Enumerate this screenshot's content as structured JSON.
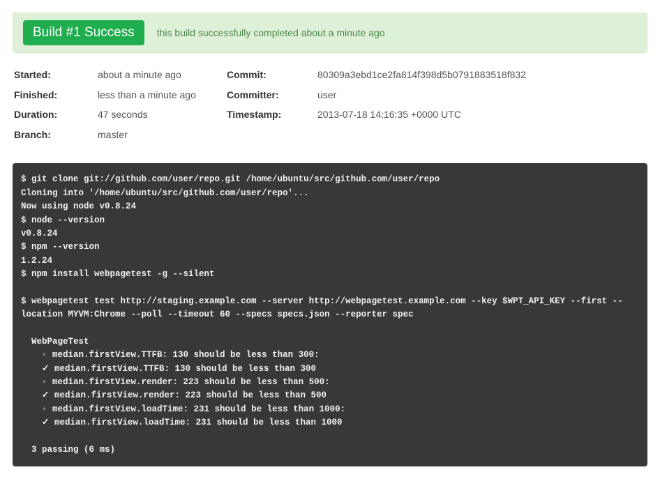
{
  "alert": {
    "badge": "Build #1 Success",
    "message": "this build successfully completed about a minute ago"
  },
  "meta": {
    "left": [
      {
        "label": "Started:",
        "value": "about a minute ago"
      },
      {
        "label": "Finished:",
        "value": "less than a minute ago"
      },
      {
        "label": "Duration:",
        "value": "47 seconds"
      },
      {
        "label": "Branch:",
        "value": "master"
      }
    ],
    "right": [
      {
        "label": "Commit:",
        "value": "80309a3ebd1ce2fa814f398d5b0791883518f832"
      },
      {
        "label": "Committer:",
        "value": "user"
      },
      {
        "label": "Timestamp:",
        "value": "2013-07-18 14:16:35 +0000 UTC"
      }
    ]
  },
  "terminal": "$ git clone git://github.com/user/repo.git /home/ubuntu/src/github.com/user/repo\nCloning into '/home/ubuntu/src/github.com/user/repo'...\nNow using node v0.8.24\n$ node --version\nv0.8.24\n$ npm --version\n1.2.24\n$ npm install webpagetest -g --silent\n\n$ webpagetest test http://staging.example.com --server http://webpagetest.example.com --key $WPT_API_KEY --first --location MYVM:Chrome --poll --timeout 60 --specs specs.json --reporter spec\n\n  WebPageTest\n    ◦ median.firstView.TTFB: 130 should be less than 300:\n    ✓ median.firstView.TTFB: 130 should be less than 300\n    ◦ median.firstView.render: 223 should be less than 500:\n    ✓ median.firstView.render: 223 should be less than 500\n    ◦ median.firstView.loadTime: 231 should be less than 1000:\n    ✓ median.firstView.loadTime: 231 should be less than 1000\n\n  3 passing (6 ms)"
}
